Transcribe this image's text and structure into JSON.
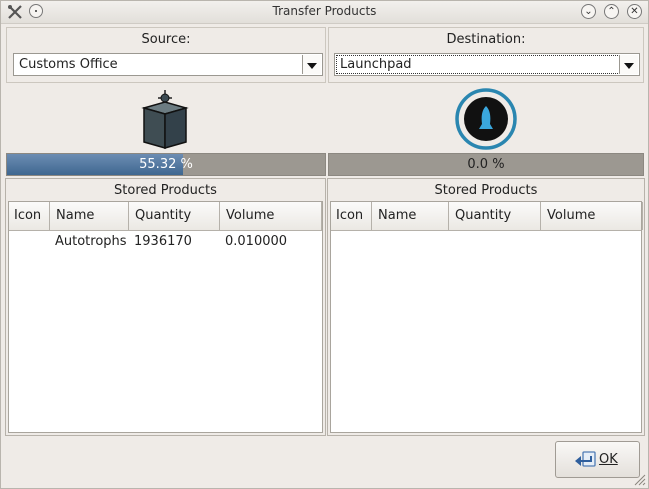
{
  "window": {
    "title": "Transfer Products"
  },
  "titlebar": {
    "minimize_glyph": "⌄",
    "maximize_glyph": "⌃",
    "close_glyph": "✕"
  },
  "source": {
    "label": "Source:",
    "selected": "Customs Office",
    "icon": "customs-office-icon",
    "progress_text": "55.32 %",
    "progress_fraction": 0.5532,
    "group_title": "Stored Products",
    "columns": [
      "Icon",
      "Name",
      "Quantity",
      "Volume"
    ],
    "rows": [
      {
        "icon": "",
        "name": "Autotrophs",
        "quantity": "1936170",
        "volume": "0.010000"
      }
    ]
  },
  "destination": {
    "label": "Destination:",
    "selected": "Launchpad",
    "icon": "launchpad-icon",
    "progress_text": "0.0 %",
    "progress_fraction": 0.0,
    "group_title": "Stored Products",
    "columns": [
      "Icon",
      "Name",
      "Quantity",
      "Volume"
    ],
    "rows": []
  },
  "buttons": {
    "ok": "OK"
  },
  "colors": {
    "progress_fill": "#4a7099",
    "progress_track": "#9c9891",
    "launchpad_ring": "#2a86b0"
  }
}
